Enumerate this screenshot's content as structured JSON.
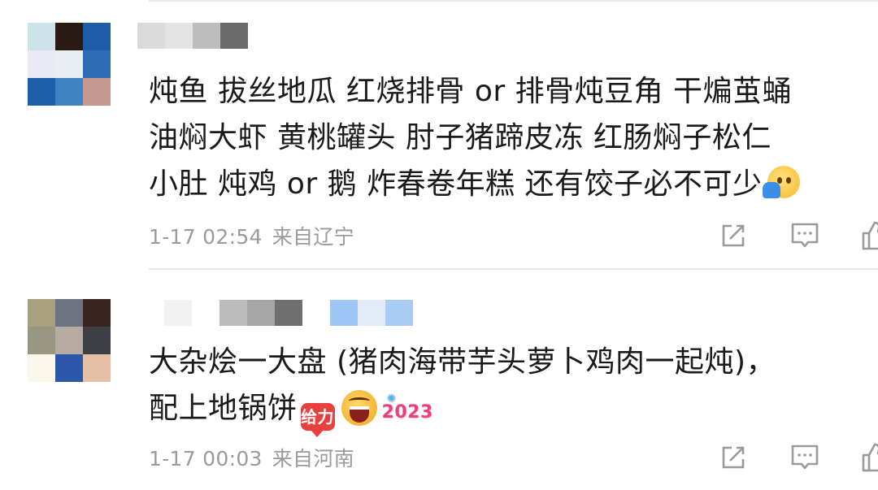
{
  "comments": [
    {
      "text_lines": [
        "炖鱼 拔丝地瓜 红烧排骨 or 排骨炖豆角 干煸茧蛹",
        "油焖大虾 黄桃罐头 肘子猪蹄皮冻 红肠焖子松仁",
        "小肚 炖鸡 or 鹅 炸春卷年糕 还有饺子必不可少"
      ],
      "emojis": [
        "saluting-face-emoji"
      ],
      "timestamp": "1-17 02:54",
      "location": "来自辽宁",
      "avatar_colors": [
        "#cde3ea",
        "#2a1a14",
        "#1e5ca8",
        "#eaeaf6",
        "#e8eef2",
        "#2e6db5",
        "#1d5fa8",
        "#3f82c4",
        "#c49a90"
      ],
      "name_mask_colors": [
        "#dadada",
        "#e4e4e4",
        "#bdbdbd",
        "#6b6b6b"
      ]
    },
    {
      "text_lines": [
        "大杂烩一大盘 (猪肉海带芋头萝卜鸡肉一起炖)，",
        "配上地锅饼"
      ],
      "emojis": [
        "cheer-emoji",
        "laughing-face-emoji",
        "year-2023-emoji"
      ],
      "emoji_cheer_label": "给力",
      "emoji_year_label": "2023",
      "timestamp": "1-17 00:03",
      "location": "来自河南",
      "avatar_colors": [
        "#a8a07e",
        "#6e7382",
        "#3a2521",
        "#999782",
        "#b8aba1",
        "#3e3f44",
        "#fbf7ea",
        "#2b57a8",
        "#e5bfa6"
      ],
      "name_mask_colors": [
        "#ffffff",
        "#f2f2f2",
        "#ffffff",
        "#bcbcbc",
        "#a6a6a6",
        "#6f6f6f",
        "#ffffff",
        "#9cc6f5",
        "#e2ecf8",
        "#a9ccf4"
      ]
    }
  ],
  "actions": {
    "share_icon": "share-icon",
    "comment_icon": "comment-icon",
    "like_icon": "thumbs-up-icon"
  }
}
